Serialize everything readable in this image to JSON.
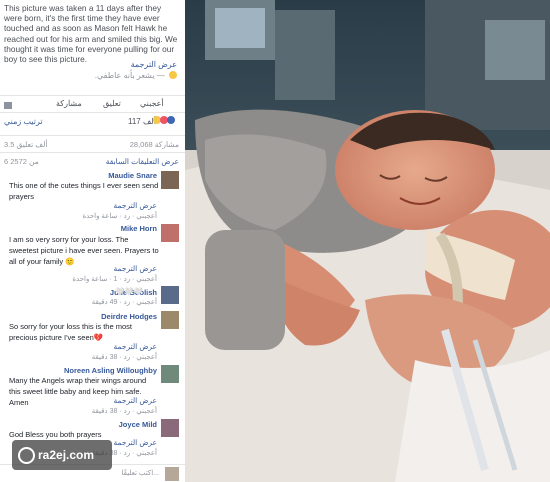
{
  "post": {
    "caption": "This picture was taken a 11 days after they were born, it's the first time they have ever touched and as soon as Mason felt Hawk he reached out for his arm and smiled this big. We thought it was time for everyone pulling for our boy to see this picture.",
    "see_translation": "عرض الترجمة",
    "feeling": "— يشعر بأنه عاطفي."
  },
  "actions": {
    "like": "أعجبني",
    "comment": "تعليق",
    "share": "مشاركة"
  },
  "reactions": {
    "sort": "ترتيب زمني",
    "count": "117 ألف"
  },
  "stats": {
    "shares": "28,068 مشاركة",
    "comments": "3.5 ألف تعليق"
  },
  "comments_header": {
    "previous": "عرض التعليقات السابقة",
    "count": "6 من 2572"
  },
  "comments": [
    {
      "name": "Maudie Snare",
      "text": "This one of the cutes things I ever seen send prayers",
      "translate": "عرض الترجمة",
      "meta": "أعجبني · رد · ساعة واحدة"
    },
    {
      "name": "Mike Horn",
      "text": "I am so very sorry for your loss. The sweetest picture i have ever seen. Prayers to all of your family 🙂",
      "translate": "عرض الترجمة",
      "meta": "أعجبني · رد · 1 · ساعة واحدة"
    },
    {
      "name": "Julie Goolish",
      "text": "🤍🤍🤍",
      "translate": "",
      "meta": "أعجبني · رد · 49 دقيقة"
    },
    {
      "name": "Deirdre Hodges",
      "text": "So sorry for your loss this is the most precious picture I've seen💔",
      "translate": "عرض الترجمة",
      "meta": "أعجبني · رد · 38 دقيقة"
    },
    {
      "name": "Noreen Asling Willoughby",
      "text": "Many the Angels wrap their wings around this sweet little baby and keep him safe. Amen",
      "translate": "عرض الترجمة",
      "meta": "أعجبني · رد · 38 دقيقة"
    },
    {
      "name": "Joyce Mild",
      "text": "God Bless you both prayers",
      "translate": "عرض الترجمة",
      "meta": "أعجبني · رد · 38 دقيقة"
    }
  ],
  "write_placeholder": "اكتب تعليقًا...",
  "watermark": "ra2ej.com"
}
